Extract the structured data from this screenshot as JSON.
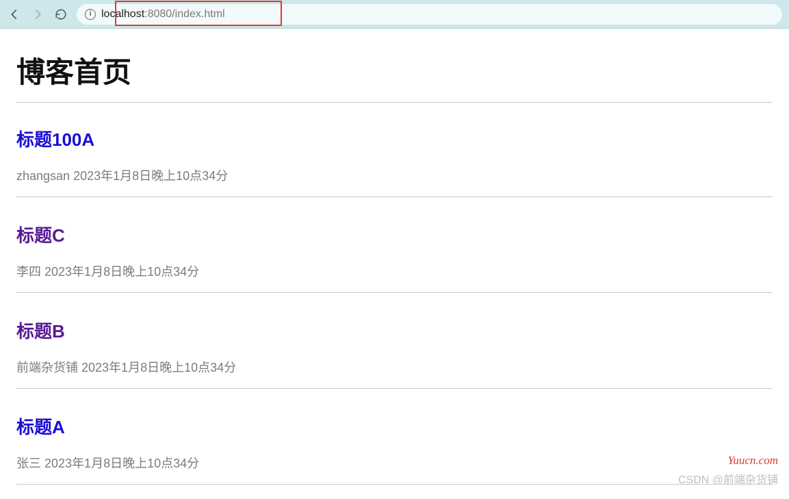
{
  "browser": {
    "url_host": "localhost",
    "url_port": ":8080",
    "url_path": "/index.html",
    "info_glyph": "i"
  },
  "header": {
    "title": "博客首页"
  },
  "posts": [
    {
      "title": "标题100A",
      "author": "zhangsan",
      "time": "2023年1月8日晚上10点34分",
      "visited": false
    },
    {
      "title": "标题C",
      "author": "李四",
      "time": "2023年1月8日晚上10点34分",
      "visited": true
    },
    {
      "title": "标题B",
      "author": "前端杂货铺",
      "time": "2023年1月8日晚上10点34分",
      "visited": true
    },
    {
      "title": "标题A",
      "author": "张三",
      "time": "2023年1月8日晚上10点34分",
      "visited": false
    }
  ],
  "watermarks": {
    "yuucn": "Yuucn.com",
    "csdn": "CSDN @前端杂货铺"
  }
}
